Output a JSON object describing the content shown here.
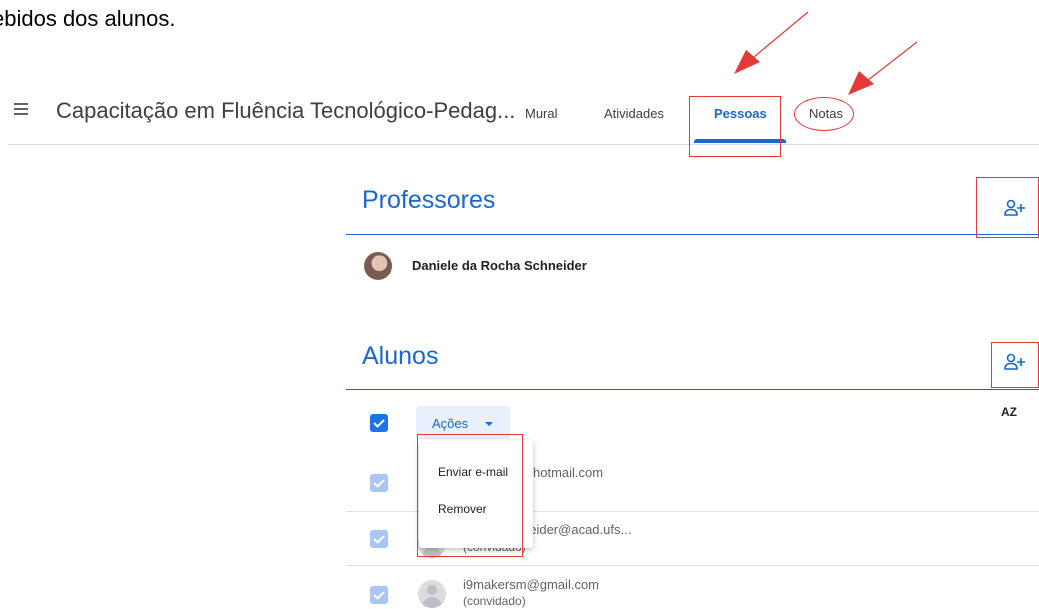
{
  "page_text": "ebidos dos alunos.",
  "header": {
    "course_title": "Capacitação em Fluência Tecnológico-Pedag...",
    "tabs": [
      {
        "label": "Mural"
      },
      {
        "label": "Atividades"
      },
      {
        "label": "Pessoas"
      },
      {
        "label": "Notas"
      }
    ],
    "active_tab": "Pessoas"
  },
  "teachers": {
    "title": "Professores",
    "list": [
      {
        "name": "Daniele da Rocha Schneider"
      }
    ]
  },
  "students": {
    "title": "Alunos",
    "actions_label": "Ações",
    "sort_label": "AZ",
    "actions_menu": [
      {
        "label": "Enviar e-mail"
      },
      {
        "label": "Remover"
      }
    ],
    "list": [
      {
        "email": "hotmail.com",
        "status": ""
      },
      {
        "email": "neider@acad.ufs...",
        "status": "(convidado)"
      },
      {
        "email": "i9makersm@gmail.com",
        "status": "(convidado)"
      }
    ]
  },
  "colors": {
    "accent": "#1967d2",
    "annotation": "#e53935"
  }
}
